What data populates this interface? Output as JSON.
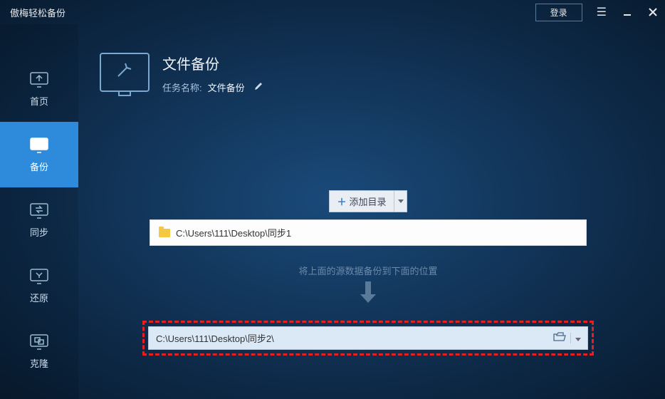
{
  "app": {
    "title": "傲梅轻松备份",
    "login": "登录"
  },
  "sidebar": {
    "items": [
      {
        "label": "首页"
      },
      {
        "label": "备份"
      },
      {
        "label": "同步"
      },
      {
        "label": "还原"
      },
      {
        "label": "克隆"
      }
    ]
  },
  "page": {
    "title": "文件备份",
    "task_label": "任务名称:",
    "task_name": "文件备份",
    "add_dir": "添加目录",
    "source_path": "C:\\Users\\111\\Desktop\\同步1",
    "hint": "将上面的源数据备份到下面的位置",
    "dest_path": "C:\\Users\\111\\Desktop\\同步2\\"
  }
}
